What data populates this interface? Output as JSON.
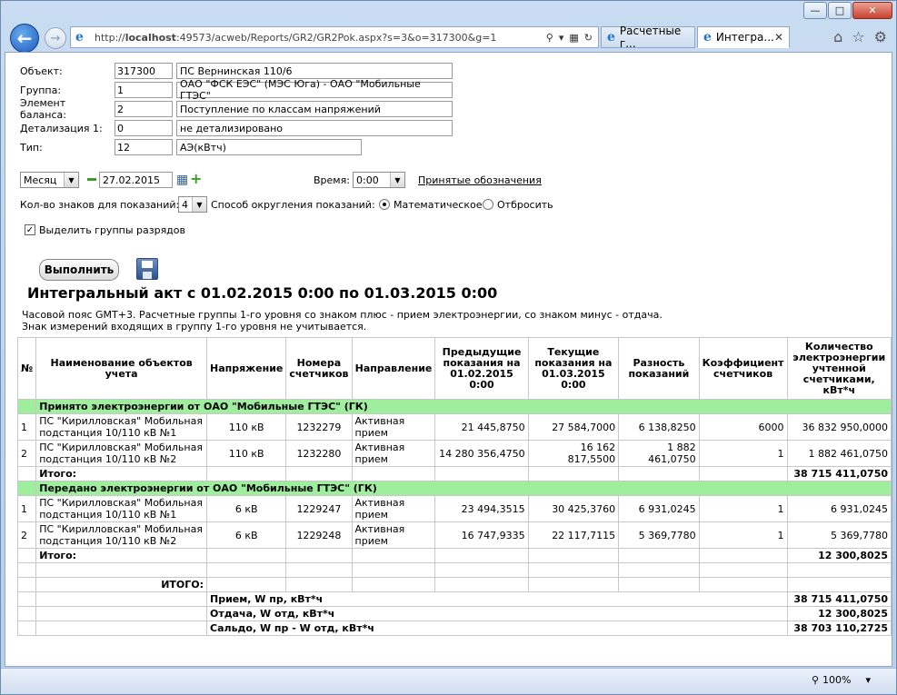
{
  "browser": {
    "url": "http://localhost:49573/acweb/Reports/GR2/GR2Pok.aspx?s=3&o=317300&g=1",
    "url_host_prefix": "http://",
    "url_host": "localhost",
    "url_rest": ":49573/acweb/Reports/GR2/GR2Pok.aspx?s=3&o=317300&g=1",
    "tabs": [
      {
        "label": "Расчетные г..."
      },
      {
        "label": "Интегра..."
      }
    ],
    "zoom": "100%"
  },
  "form": {
    "fields": [
      {
        "label": "Объект:",
        "code": "317300",
        "name": "ПС Вернинская 110/6"
      },
      {
        "label": "Группа:",
        "code": "1",
        "name": "ОАО \"ФСК ЕЭС\" (МЭС Юга) - ОАО \"Мобильные ГТЭС\""
      },
      {
        "label": "Элемент баланса:",
        "code": "2",
        "name": "Поступление по классам напряжений"
      },
      {
        "label": "Детализация 1:",
        "code": "0",
        "name": "не детализировано"
      },
      {
        "label": "Тип:",
        "code": "12",
        "name": "АЭ(кВтч)"
      }
    ],
    "period": "Месяц",
    "date": "27.02.2015",
    "time_label": "Время:",
    "time": "0:00",
    "legend_link": "Принятые обозначения",
    "digits_label": "Кол-во знаков для показаний:",
    "digits": "4",
    "rounding_label": "Способ округления показаний:",
    "rounding_options": [
      "Математическое",
      "Отбросить"
    ],
    "group_digits_label": "Выделить группы разрядов",
    "run_button": "Выполнить"
  },
  "report": {
    "title": "Интегральный акт с 01.02.2015 0:00 по 01.03.2015 0:00",
    "note1": "Часовой пояс GMT+3. Расчетные группы 1-го уровня со знаком плюс - прием электроэнергии, со знаком минус - отдача.",
    "note2": "Знак измерений входящих в группу 1-го уровня не учитывается.",
    "headers": [
      "№",
      "Наименование объектов учета",
      "Напряжение",
      "Номера счетчиков",
      "Направление",
      "Предыдущие показания на 01.02.2015 0:00",
      "Текущие показания на 01.03.2015 0:00",
      "Разность показаний",
      "Коэффициент счетчиков",
      "Количество электроэнергии учтенной счетчиками, кВт*ч"
    ],
    "sections": [
      {
        "title": "Принято электроэнергии от ОАО \"Мобильные ГТЭС\" (ГК)",
        "rows": [
          {
            "n": "1",
            "name": "ПС \"Кирилловская\" Мобильная подстанция 10/110 кВ №1",
            "voltage": "110 кВ",
            "meter": "1232279",
            "direction": "Активная прием",
            "prev": "21 445,8750",
            "curr": "27 584,7000",
            "diff": "6 138,8250",
            "coef": "6000",
            "qty": "36 832 950,0000"
          },
          {
            "n": "2",
            "name": "ПС \"Кирилловская\" Мобильная подстанция 10/110 кВ №2",
            "voltage": "110 кВ",
            "meter": "1232280",
            "direction": "Активная прием",
            "prev": "14 280 356,4750",
            "curr": "16 162 817,5500",
            "diff": "1 882 461,0750",
            "coef": "1",
            "qty": "1 882 461,0750"
          }
        ],
        "total_label": "Итого:",
        "total": "38 715 411,0750"
      },
      {
        "title": "Передано электроэнергии от ОАО \"Мобильные ГТЭС\" (ГК)",
        "rows": [
          {
            "n": "1",
            "name": "ПС \"Кирилловская\" Мобильная подстанция 10/110 кВ №1",
            "voltage": "6 кВ",
            "meter": "1229247",
            "direction": "Активная прием",
            "prev": "23 494,3515",
            "curr": "30 425,3760",
            "diff": "6 931,0245",
            "coef": "1",
            "qty": "6 931,0245"
          },
          {
            "n": "2",
            "name": "ПС \"Кирилловская\" Мобильная подстанция 10/110 кВ №2",
            "voltage": "6 кВ",
            "meter": "1229248",
            "direction": "Активная прием",
            "prev": "16 747,9335",
            "curr": "22 117,7115",
            "diff": "5 369,7780",
            "coef": "1",
            "qty": "5 369,7780"
          }
        ],
        "total_label": "Итого:",
        "total": "12 300,8025"
      }
    ],
    "grand_label": "ИТОГО:",
    "summary": [
      {
        "label": "Прием, W пр, кВт*ч",
        "value": "38 715 411,0750"
      },
      {
        "label": "Отдача, W отд, кВт*ч",
        "value": "12 300,8025"
      },
      {
        "label": "Сальдо, W пр - W отд, кВт*ч",
        "value": "38 703 110,2725"
      }
    ]
  }
}
